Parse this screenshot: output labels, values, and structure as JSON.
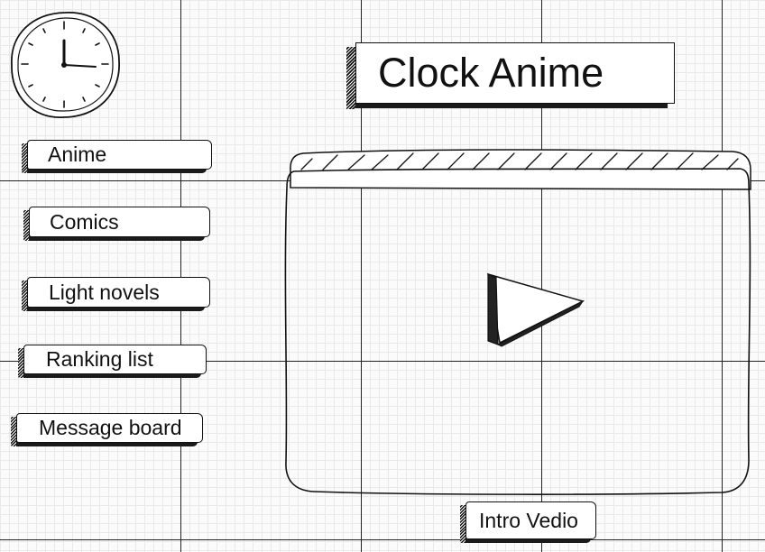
{
  "app": {
    "title": "Clock Anime"
  },
  "nav": {
    "items": [
      {
        "label": "Anime"
      },
      {
        "label": "Comics"
      },
      {
        "label": "Light novels"
      },
      {
        "label": "Ranking list"
      },
      {
        "label": "Message board"
      }
    ]
  },
  "player": {
    "icon": "play-icon",
    "intro_label": "Intro Vedio"
  },
  "logo": {
    "icon": "clock-icon"
  },
  "colors": {
    "ink": "#111111",
    "paper": "#fbfbfb",
    "grid": "#e9e9e9",
    "box_fill": "#ffffff"
  }
}
